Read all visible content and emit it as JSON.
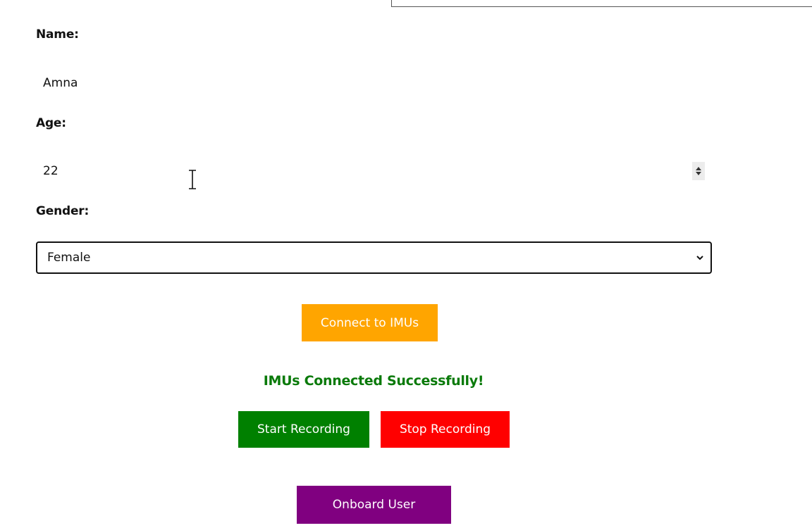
{
  "form": {
    "name_label": "Name:",
    "name_value": "Amna",
    "age_label": "Age:",
    "age_value": "22",
    "gender_label": "Gender:",
    "gender_selected": "Female"
  },
  "actions": {
    "connect_label": "Connect to IMUs",
    "status_message": "IMUs Connected Successfully!",
    "start_label": "Start Recording",
    "stop_label": "Stop Recording",
    "onboard_label": "Onboard User"
  },
  "colors": {
    "connect": "#ffa500",
    "status": "#0a7a0a",
    "start": "#008000",
    "stop": "#ff0000",
    "onboard": "#800080"
  }
}
